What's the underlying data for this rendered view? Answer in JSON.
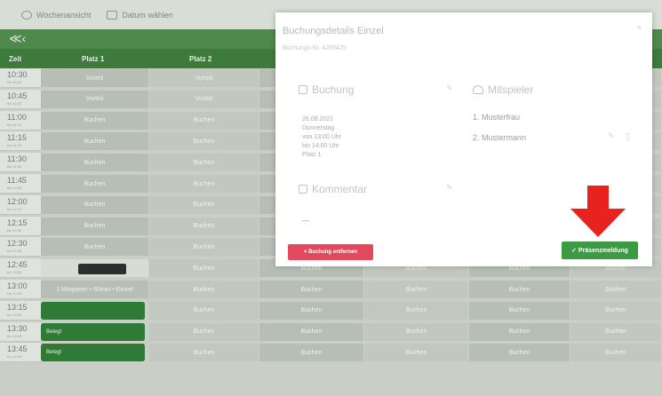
{
  "toolbar": {
    "week_view": "Wochenansicht",
    "choose_date": "Datum wählen"
  },
  "nav": {
    "arrows": "≪ ‹"
  },
  "columns": {
    "time": "Zeit",
    "court1": "Platz 1",
    "court2": "Platz 2"
  },
  "rows": [
    {
      "time": "10:30",
      "sub": "bis 10:45",
      "c1": "Vorteil",
      "c2": "Vorteil",
      "c3": "",
      "c4": "",
      "c5": "",
      "c6": ""
    },
    {
      "time": "10:45",
      "sub": "bis 11:00",
      "c1": "Vorteil",
      "c2": "Vorteil",
      "c3": "",
      "c4": "",
      "c5": "",
      "c6": ""
    },
    {
      "time": "11:00",
      "sub": "bis 11:15",
      "c1": "Buchen",
      "c2": "Buchen",
      "c3": "",
      "c4": "",
      "c5": "",
      "c6": ""
    },
    {
      "time": "11:15",
      "sub": "bis 11:30",
      "c1": "Buchen",
      "c2": "Buchen",
      "c3": "",
      "c4": "",
      "c5": "",
      "c6": ""
    },
    {
      "time": "11:30",
      "sub": "bis 11:45",
      "c1": "Buchen",
      "c2": "Buchen",
      "c3": "",
      "c4": "",
      "c5": "",
      "c6": ""
    },
    {
      "time": "11:45",
      "sub": "bis 12:00",
      "c1": "Buchen",
      "c2": "Buchen",
      "c3": "",
      "c4": "",
      "c5": "",
      "c6": ""
    },
    {
      "time": "12:00",
      "sub": "bis 12:15",
      "c1": "Buchen",
      "c2": "Buchen",
      "c3": "",
      "c4": "",
      "c5": "",
      "c6": ""
    },
    {
      "time": "12:15",
      "sub": "bis 12:30",
      "c1": "Buchen",
      "c2": "Buchen",
      "c3": "",
      "c4": "",
      "c5": "",
      "c6": ""
    },
    {
      "time": "12:30",
      "sub": "bis 12:45",
      "c1": "Buchen",
      "c2": "Buchen",
      "c3": "",
      "c4": "",
      "c5": "",
      "c6": ""
    },
    {
      "time": "12:45",
      "sub": "bis 13:00",
      "c1": "",
      "c2": "Buchen",
      "c3": "Buchen",
      "c4": "Buchen",
      "c5": "Buchen",
      "c6": "Buchen"
    },
    {
      "time": "13:00",
      "sub": "bis 13:15",
      "c1": "1 Mitspieler • 60min • Einzel",
      "c2": "Buchen",
      "c3": "Buchen",
      "c4": "Buchen",
      "c5": "Buchen",
      "c6": "Buchen"
    },
    {
      "time": "13:15",
      "sub": "bis 13:30",
      "c1": "",
      "c2": "Buchen",
      "c3": "Buchen",
      "c4": "Buchen",
      "c5": "Buchen",
      "c6": "Buchen"
    },
    {
      "time": "13:30",
      "sub": "bis 13:45",
      "c1": "Belegt",
      "c2": "Buchen",
      "c3": "Buchen",
      "c4": "Buchen",
      "c5": "Buchen",
      "c6": "Buchen"
    },
    {
      "time": "13:45",
      "sub": "bis 14:00",
      "c1": "Belegt",
      "c2": "Buchen",
      "c3": "Buchen",
      "c4": "Buchen",
      "c5": "Buchen",
      "c6": "Buchen"
    }
  ],
  "modal": {
    "title": "Buchungsdetails Einzel",
    "subtitle": "Buchungs-Nr. 4259425",
    "close": "×",
    "booking_heading": "Buchung",
    "players_heading": "Mitspieler",
    "details": [
      "26.08.2021",
      "Donnerstag",
      "von 13:00 Uhr",
      "bis 14:00 Uhr",
      "Platz 1"
    ],
    "players": [
      "1. Musterfrau",
      "2. Mustermann"
    ],
    "comment_heading": "Kommentar",
    "remove_button": "× Buchung entfernen",
    "present_button": "✓ Präsenzmeldung"
  },
  "colors": {
    "green": "#3c9a44",
    "red": "#e2495e",
    "arrow": "#e8231f"
  }
}
